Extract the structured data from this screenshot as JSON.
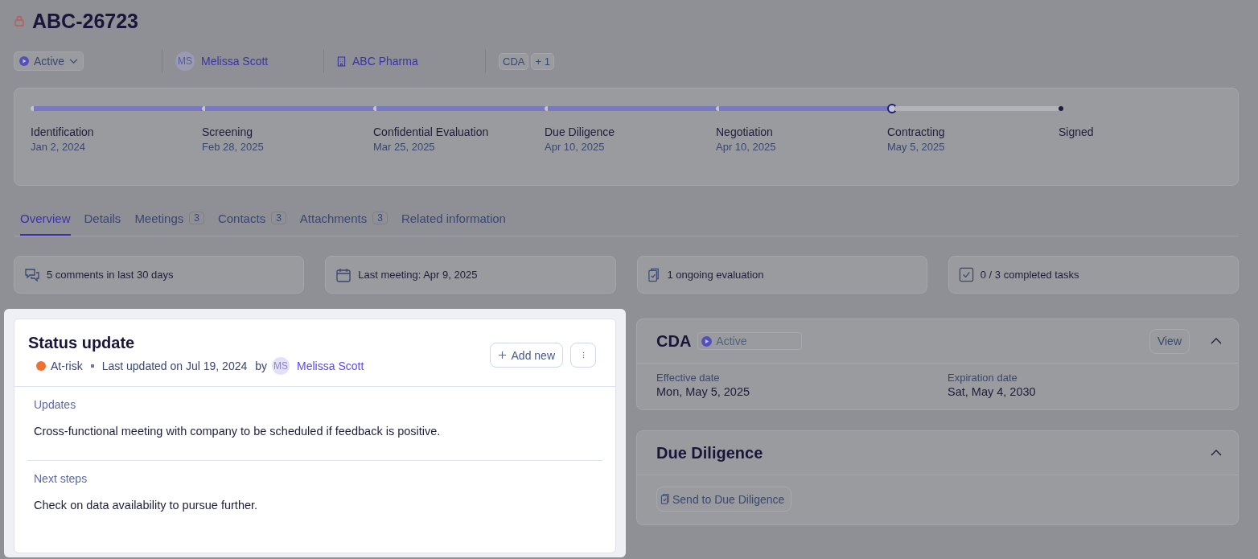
{
  "header": {
    "title": "ABC-26723",
    "locked": true,
    "status": "Active",
    "owner": {
      "initials": "MS",
      "name": "Melissa Scott"
    },
    "company": "ABC Pharma",
    "tags": [
      "CDA"
    ],
    "more_tags": "+ 1"
  },
  "stages": [
    {
      "name": "Identification",
      "date": "Jan 2, 2024",
      "done": true,
      "current": false
    },
    {
      "name": "Screening",
      "date": "Feb 28, 2025",
      "done": true,
      "current": false
    },
    {
      "name": "Confidential Evaluation",
      "date": "Mar 25, 2025",
      "done": true,
      "current": false
    },
    {
      "name": "Due Diligence",
      "date": "Apr 10, 2025",
      "done": true,
      "current": false
    },
    {
      "name": "Negotiation",
      "date": "Apr 10, 2025",
      "done": true,
      "current": false
    },
    {
      "name": "Contracting",
      "date": "May 5, 2025",
      "done": false,
      "current": true
    },
    {
      "name": "Signed",
      "done": false,
      "current": false
    }
  ],
  "tabs": [
    {
      "label": "Overview",
      "selected": true
    },
    {
      "label": "Details",
      "selected": false
    },
    {
      "label": "Meetings",
      "count": "3",
      "selected": false
    },
    {
      "label": "Contacts",
      "count": "3",
      "selected": false
    },
    {
      "label": "Attachments",
      "count": "3",
      "selected": false
    },
    {
      "label": "Related information",
      "selected": false
    }
  ],
  "stats": [
    {
      "kind": "comments",
      "text": "5 comments in last 30 days"
    },
    {
      "kind": "calendar",
      "text": "Last meeting: Apr 9, 2025"
    },
    {
      "kind": "clipboard",
      "text": "1 ongoing evaluation"
    },
    {
      "kind": "checkbox",
      "text": "0 / 3 completed tasks"
    }
  ],
  "status_update": {
    "title": "Status update",
    "status": {
      "label": "At-risk",
      "color": "#f07030"
    },
    "updated": "Last updated on Jul 19, 2024",
    "by": "by",
    "author": {
      "initials": "MS",
      "name": "Melissa Scott"
    },
    "add_button": "Add new",
    "sections": [
      {
        "heading": "Updates",
        "text": "Cross-functional meeting with company to be scheduled if feedback is positive."
      },
      {
        "heading": "Next steps",
        "text": "Check on data availability to pursue further."
      }
    ]
  },
  "cda": {
    "title": "CDA",
    "status": "Active",
    "view_button": "View",
    "expanded": true,
    "fields": [
      {
        "label": "Effective date",
        "value": "Mon, May 5, 2025"
      },
      {
        "label": "Expiration date",
        "value": "Sat, May 4, 2030"
      }
    ]
  },
  "due_diligence": {
    "title": "Due Diligence",
    "expanded": true,
    "button": "Send to Due Diligence"
  }
}
